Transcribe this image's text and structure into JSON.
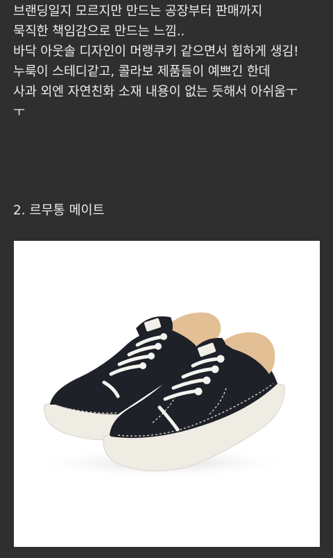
{
  "post": {
    "paragraph_lines": [
      "브랜딩일지 모르지만 만드는 공장부터 판매까지",
      "묵직한 책임감으로 만드는 느낌..",
      "바닥 아웃솔 디자인이 머랭쿠키 같으면서 힙하게 생김!",
      "누룩이 스테디같고, 콜라보 제품들이 예쁘긴 한데",
      "사과 외엔 자연친화 소재 내용이 없는 듯해서 아쉬움ㅜ",
      "ㅜ"
    ],
    "section_heading": "2. 르무통 메이트",
    "product_image": {
      "subject": "black-knit-sneakers-pair",
      "colors": {
        "upper": "#1e2128",
        "sole": "#efece4",
        "lining": "#e3bf95",
        "laces": "#f4f4f0",
        "stitch": "#d9d6cc"
      }
    }
  }
}
